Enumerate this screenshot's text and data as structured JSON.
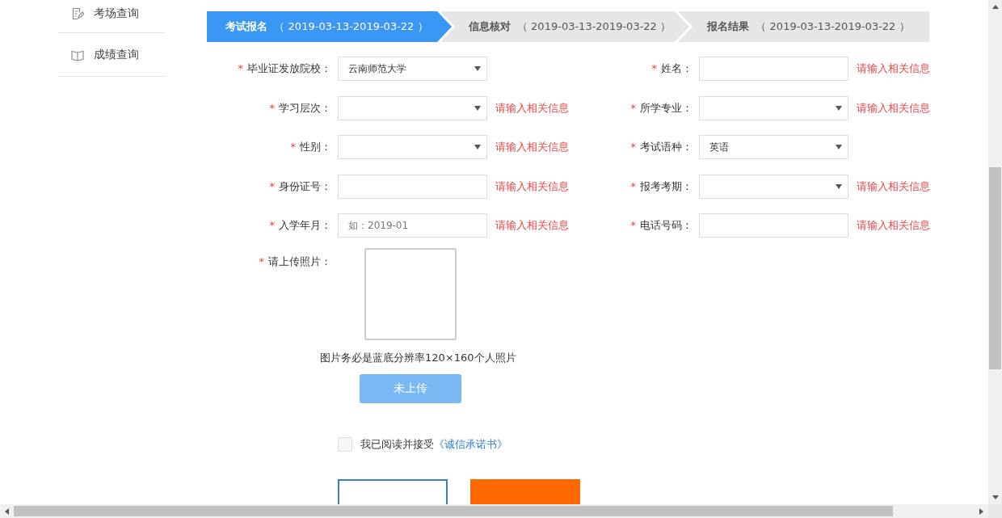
{
  "sidebar": {
    "items": [
      {
        "label": "考场查询"
      },
      {
        "label": "成绩查询"
      }
    ]
  },
  "steps": [
    {
      "label": "考试报名",
      "dates": "（ 2019-03-13-2019-03-22 ）",
      "selected": true
    },
    {
      "label": "信息核对",
      "dates": "（ 2019-03-13-2019-03-22 ）",
      "selected": false
    },
    {
      "label": "报名结果",
      "dates": "（ 2019-03-13-2019-03-22 ）",
      "selected": false
    }
  ],
  "form": {
    "left_fields": [
      {
        "label": "毕业证发放院校：",
        "star": "*",
        "kind": "select",
        "value": "云南师范大学"
      },
      {
        "label": "学习层次：",
        "star": "*",
        "kind": "select",
        "error": "请输入相关信息"
      },
      {
        "label": "性别：",
        "star": "*",
        "kind": "select",
        "error": "请输入相关信息"
      },
      {
        "label": "身份证号：",
        "star": "*",
        "kind": "text",
        "error": "请输入相关信息"
      },
      {
        "label": "入学年月：",
        "star": "*",
        "kind": "text",
        "placeholder": "如：2019-01",
        "error": "请输入相关信息"
      }
    ],
    "right_fields": [
      {
        "label": "姓名：",
        "star": "*",
        "kind": "text",
        "error": "请输入相关信息"
      },
      {
        "label": "所学专业：",
        "star": "*",
        "kind": "select",
        "error": "请输入相关信息"
      },
      {
        "label": "考试语种：",
        "star": "*",
        "kind": "select",
        "value": "英语"
      },
      {
        "label": "报考考期：",
        "star": "*",
        "kind": "select",
        "error": "请输入相关信息"
      },
      {
        "label": "电话号码：",
        "star": "*",
        "kind": "text",
        "error": "请输入相关信息"
      }
    ],
    "photo": {
      "label": "请上传照片：",
      "star": "*",
      "hint": "图片务必是蓝底分辨率120×160个人照片",
      "button": "未上传"
    },
    "agreement": {
      "checked": false,
      "text": "我已阅读并接受",
      "link": "《诚信承诺书》"
    }
  }
}
